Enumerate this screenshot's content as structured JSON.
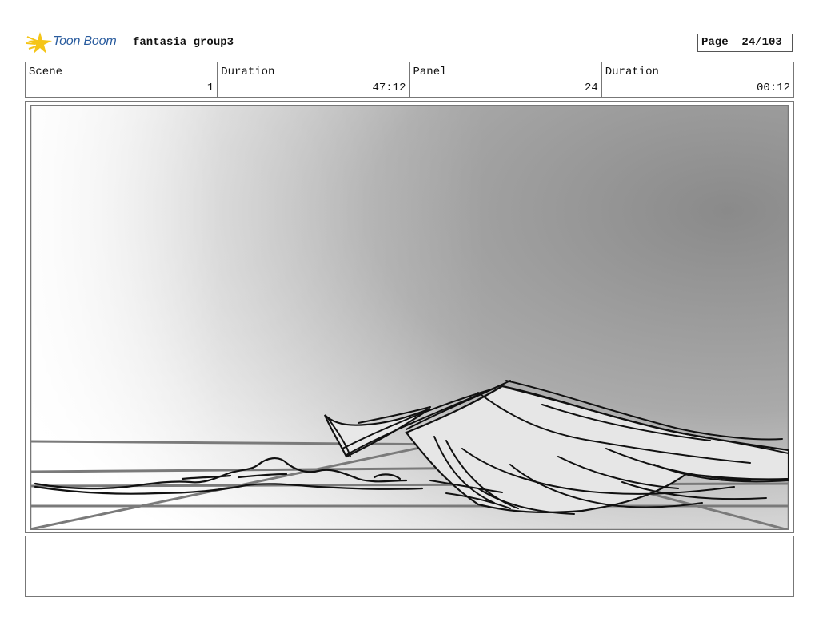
{
  "header": {
    "logo_text": "Toon Boom",
    "project_title": "fantasia group3",
    "page_label": "Page",
    "page_value": "24/103"
  },
  "info": [
    {
      "label": "Scene",
      "value": "1"
    },
    {
      "label": "Duration",
      "value": "47:12"
    },
    {
      "label": "Panel",
      "value": "24"
    },
    {
      "label": "Duration",
      "value": "00:12"
    }
  ],
  "notes": {
    "text": ""
  }
}
